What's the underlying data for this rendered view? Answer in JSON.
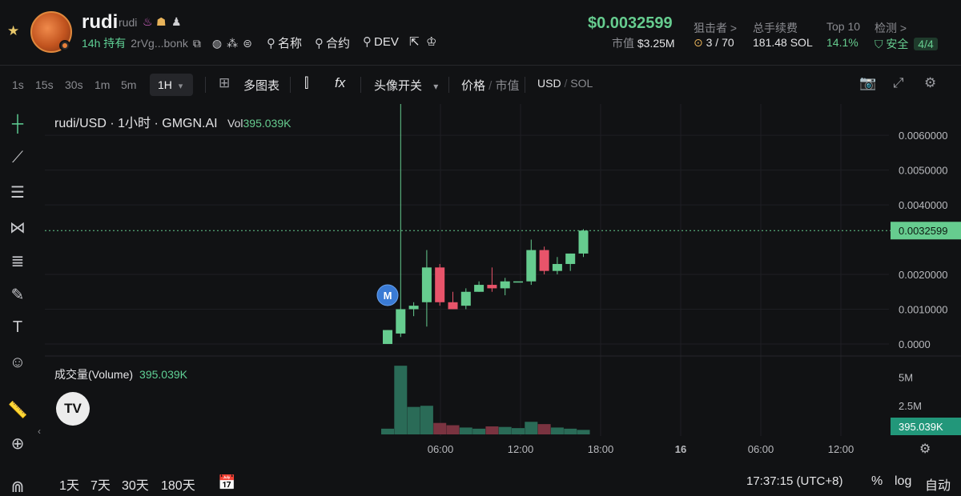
{
  "header": {
    "token_name": "rudi",
    "token_sub": "rudi",
    "hold_time": "14h 持有",
    "address": "2rVg...bonk",
    "links": [
      {
        "icon": "search-icon",
        "label": "名称"
      },
      {
        "icon": "search-icon",
        "label": "合约"
      },
      {
        "icon": "search-icon",
        "label": "DEV"
      }
    ],
    "price": "$0.0032599",
    "market_cap_label": "市值",
    "market_cap_value": "$3.25M",
    "stats": [
      {
        "label": "狙击者 >",
        "value": "3 / 70"
      },
      {
        "label": "总手续费",
        "value": "181.48 SOL"
      },
      {
        "label": "Top 10",
        "value": "14.1%"
      },
      {
        "label": "检测 >",
        "value": "安全",
        "badge": "4/4"
      }
    ]
  },
  "toolbar": {
    "timeframes": [
      "1s",
      "15s",
      "30s",
      "1m",
      "5m"
    ],
    "active_timeframe": "1H",
    "multi_chart": "多图表",
    "avatar_toggle": "头像开关",
    "price_label": "价格",
    "mcap_label": "市值",
    "usd_label": "USD",
    "sol_label": "SOL"
  },
  "chart": {
    "legend_title": "rudi/USD · 1小时 · GMGN.AI",
    "vol_label": "Vol",
    "vol_value": "395.039K",
    "volume_title": "成交量(Volume)",
    "volume_value": "395.039K",
    "marker_label": "M",
    "tv_logo": "TV"
  },
  "chart_data": {
    "type": "candlestick",
    "title": "rudi/USD · 1小时 · GMGN.AI",
    "price_axis": {
      "ticks": [
        "0.0060000",
        "0.0050000",
        "0.0040000",
        "0.0020000",
        "0.0010000",
        "0.0000"
      ],
      "ylim": [
        -0.0003,
        0.0069
      ],
      "current_price_label": "0.0032599",
      "current_price": 0.0032599
    },
    "volume_axis": {
      "ticks": [
        "5M",
        "2.5M"
      ],
      "ylim": [
        0,
        6500000
      ],
      "current_volume_label": "395.039K"
    },
    "time_axis": {
      "ticks": [
        "06:00",
        "12:00",
        "18:00",
        "16",
        "06:00",
        "12:00"
      ]
    },
    "candles": [
      {
        "o": 0.0,
        "h": 0.0004,
        "l": 0.0,
        "c": 0.0004,
        "v": 500000
      },
      {
        "o": 0.0003,
        "h": 0.0069,
        "l": 0.0002,
        "c": 0.001,
        "v": 6000000
      },
      {
        "o": 0.001,
        "h": 0.0012,
        "l": 0.0008,
        "c": 0.0011,
        "v": 2400000
      },
      {
        "o": 0.0012,
        "h": 0.0027,
        "l": 0.0005,
        "c": 0.0022,
        "v": 2500000
      },
      {
        "o": 0.0022,
        "h": 0.0023,
        "l": 0.0011,
        "c": 0.0012,
        "v": 1000000
      },
      {
        "o": 0.0012,
        "h": 0.0015,
        "l": 0.001,
        "c": 0.001,
        "v": 800000
      },
      {
        "o": 0.0011,
        "h": 0.0016,
        "l": 0.001,
        "c": 0.0015,
        "v": 600000
      },
      {
        "o": 0.0015,
        "h": 0.0018,
        "l": 0.0015,
        "c": 0.0017,
        "v": 500000
      },
      {
        "o": 0.0017,
        "h": 0.0022,
        "l": 0.0015,
        "c": 0.0016,
        "v": 700000
      },
      {
        "o": 0.0016,
        "h": 0.0019,
        "l": 0.0014,
        "c": 0.0018,
        "v": 650000
      },
      {
        "o": 0.0018,
        "h": 0.0018,
        "l": 0.0018,
        "c": 0.0018,
        "v": 550000
      },
      {
        "o": 0.0018,
        "h": 0.003,
        "l": 0.0017,
        "c": 0.0027,
        "v": 1100000
      },
      {
        "o": 0.0027,
        "h": 0.0028,
        "l": 0.002,
        "c": 0.0021,
        "v": 900000
      },
      {
        "o": 0.0021,
        "h": 0.0025,
        "l": 0.002,
        "c": 0.0023,
        "v": 600000
      },
      {
        "o": 0.0023,
        "h": 0.0026,
        "l": 0.0021,
        "c": 0.0026,
        "v": 500000
      },
      {
        "o": 0.0026,
        "h": 0.0033,
        "l": 0.0025,
        "c": 0.0032599,
        "v": 395039
      }
    ]
  },
  "left_tools": [
    "crosshair-icon",
    "trendline-icon",
    "fib-icon",
    "pattern-icon",
    "forecast-icon",
    "brush-icon",
    "text-icon",
    "emoji-icon",
    "ruler-icon",
    "zoom-icon",
    "magnet-icon"
  ],
  "bottom": {
    "ranges": [
      "1天",
      "7天",
      "30天",
      "180天"
    ],
    "clock": "17:37:15 (UTC+8)",
    "percent": "%",
    "log": "log",
    "auto": "自动"
  },
  "colors": {
    "up": "#66cc8f",
    "down": "#e8546a",
    "background": "#111214"
  }
}
